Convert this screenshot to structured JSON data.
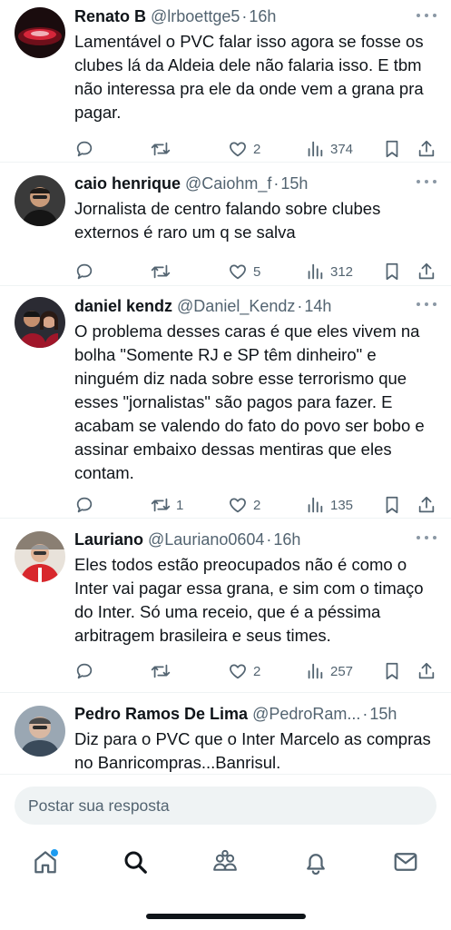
{
  "tweets": [
    {
      "name": "Renato B",
      "handle": "@lrboettge5",
      "time": "16h",
      "text": "Lamentável o PVC falar isso agora se fosse os clubes lá da Aldeia dele não falaria isso. E tbm não interessa pra ele da onde vem a grana pra pagar.",
      "replies": "",
      "retweets": "",
      "likes": "2",
      "views": "374"
    },
    {
      "name": "caio henrique",
      "handle": "@Caiohm_f",
      "time": "15h",
      "text": "Jornalista de centro falando sobre clubes externos é raro um q se salva",
      "replies": "",
      "retweets": "",
      "likes": "5",
      "views": "312"
    },
    {
      "name": "daniel kendz",
      "handle": "@Daniel_Kendz",
      "time": "14h",
      "text": "O problema desses caras é que eles vivem na bolha \"Somente RJ e SP têm dinheiro\" e ninguém diz nada sobre esse terrorismo que esses \"jornalistas\" são pagos para fazer. E acabam se valendo do fato do povo ser bobo e assinar embaixo dessas mentiras que eles contam.",
      "replies": "",
      "retweets": "1",
      "likes": "2",
      "views": "135"
    },
    {
      "name": "Lauriano",
      "handle": "@Lauriano0604",
      "time": "16h",
      "text": "Eles todos estão preocupados não é como o Inter vai pagar essa grana, e sim com o timaço do Inter. Só uma receio, que é a péssima arbitragem brasileira e seus times.",
      "replies": "",
      "retweets": "",
      "likes": "2",
      "views": "257"
    },
    {
      "name": "Pedro Ramos De Lima",
      "handle": "@PedroRam...",
      "time": "15h",
      "text": "Diz para o PVC que o Inter  Marcelo as compras no Banricompras...Banrisul.",
      "replies": "",
      "retweets": "",
      "likes": "",
      "views": ""
    }
  ],
  "reply_bar": {
    "placeholder": "Postar sua resposta"
  },
  "nav": {
    "icons": [
      "home-icon",
      "search-icon",
      "communities-icon",
      "notifications-icon",
      "messages-icon"
    ]
  },
  "colors": {
    "accent": "#1d9bf0",
    "text": "#0f1419",
    "secondary": "#536471"
  },
  "separator": "·"
}
